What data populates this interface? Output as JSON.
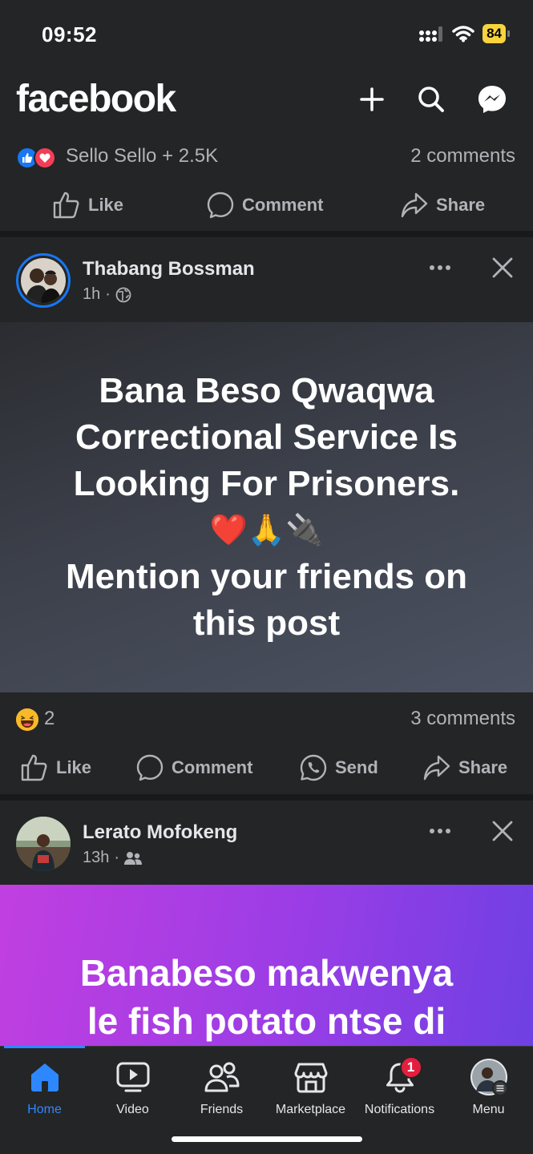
{
  "status": {
    "time": "09:52",
    "battery": "84"
  },
  "header": {
    "logo": "facebook",
    "icons": [
      "plus-icon",
      "search-icon",
      "messenger-icon"
    ]
  },
  "prev_post": {
    "reaction_names": "Sello Sello + 2.5K",
    "comments": "2 comments",
    "actions": {
      "like": "Like",
      "comment": "Comment",
      "share": "Share"
    }
  },
  "post1": {
    "author": "Thabang Bossman",
    "time": "1h",
    "privacy_icon": "globe-icon",
    "lines": [
      "Bana Beso Qwaqwa",
      "Correctional Service Is",
      "Looking For Prisoners."
    ],
    "emoji_line": "❤️🙏🔌",
    "lines2": [
      "Mention your friends on",
      "this post"
    ],
    "reaction_count": "2",
    "comments": "3 comments",
    "actions": {
      "like": "Like",
      "comment": "Comment",
      "send": "Send",
      "share": "Share"
    }
  },
  "post2": {
    "author": "Lerato Mofokeng",
    "time": "13h",
    "privacy_icon": "friends-icon",
    "lines": [
      "Banabeso makwenya",
      "le fish potato ntse di"
    ]
  },
  "nav": {
    "home": "Home",
    "video": "Video",
    "friends": "Friends",
    "marketplace": "Marketplace",
    "notifications": "Notifications",
    "notifications_badge": "1",
    "menu": "Menu"
  },
  "colors": {
    "accent": "#2d88ff",
    "background": "#242526",
    "badge": "#e41e3f"
  }
}
